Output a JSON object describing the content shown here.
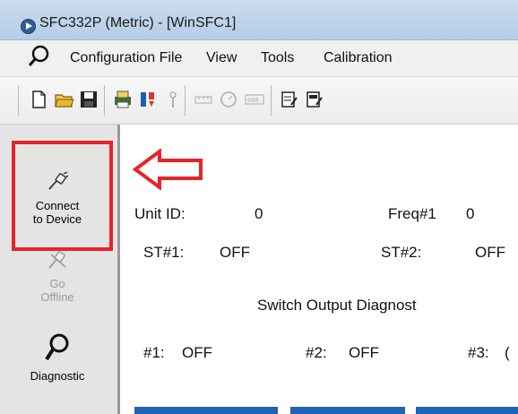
{
  "window": {
    "title": "SFC332P (Metric) - [WinSFC1]"
  },
  "menu": {
    "search_icon": "magnifier-icon",
    "items": [
      "Configuration File",
      "View",
      "Tools",
      "Calibration"
    ]
  },
  "toolbar": {
    "icons": [
      "new-file-icon",
      "open-folder-icon",
      "save-icon",
      "print-icon",
      "sort-icon",
      "probe-icon",
      "ruler-icon",
      "dial-icon",
      "counter-icon",
      "edit-doc-icon",
      "edit-doc2-icon"
    ]
  },
  "sidebar": {
    "connect": {
      "label_line1": "Connect",
      "label_line2": "to Device",
      "icon": "plug-icon"
    },
    "offline": {
      "label_line1": "Go",
      "label_line2": "Offline",
      "icon": "unplug-icon"
    },
    "diagnostic": {
      "label": "Diagnostic",
      "icon": "magnifier-icon"
    }
  },
  "annotation": {
    "color": "#e8232a"
  },
  "content": {
    "unit_id_label": "Unit ID:",
    "unit_id_value": "0",
    "freq1_label": "Freq#1",
    "freq1_value": "0",
    "st1_label": "ST#1:",
    "st1_value": "OFF",
    "st2_label": "ST#2:",
    "st2_value": "OFF",
    "switch_diag_title": "Switch Output Diagnost",
    "out1_label": "#1:",
    "out1_value": "OFF",
    "out2_label": "#2:",
    "out2_value": "OFF",
    "out3_label": "#3:",
    "out3_value": "("
  }
}
